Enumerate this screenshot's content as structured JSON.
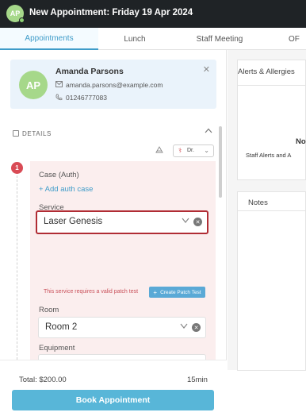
{
  "title_bar": {
    "avatar_initials": "AP",
    "title": "New Appointment: Friday 19 Apr 2024"
  },
  "tabs": [
    {
      "label": "Appointments",
      "active": true
    },
    {
      "label": "Lunch",
      "active": false
    },
    {
      "label": "Staff Meeting",
      "active": false
    },
    {
      "label": "OF",
      "active": false
    }
  ],
  "patient": {
    "initials": "AP",
    "name": "Amanda Parsons",
    "email": "amanda.parsons@example.com",
    "phone": "01246777083"
  },
  "details": {
    "heading": "DETAILS",
    "staff_select_value": "Dr.",
    "step_number": "1",
    "case_label": "Case (Auth)",
    "add_auth_label": "+ Add auth case",
    "service_label": "Service",
    "service_value": "Laser Genesis",
    "service_warning": "This service requires a valid patch test",
    "create_patch_test_label": "Create Patch Test",
    "room_label": "Room",
    "room_value": "Room 2",
    "equipment_label": "Equipment"
  },
  "footer": {
    "total": "Total: $200.00",
    "duration": "15min",
    "book_label": "Book Appointment"
  },
  "right_panel": {
    "alerts_title": "Alerts & Allergies",
    "alerts_empty_title": "No",
    "alerts_empty_sub": "Staff Alerts and A",
    "notes_title": "Notes"
  },
  "colors": {
    "title_bar": "#1f2326",
    "accent": "#3f9cc9",
    "book_button": "#58b6d8",
    "warning": "#c9505a",
    "highlight_border": "#b02c34",
    "service_panel": "#fbeeee",
    "patient_card": "#eaf3fb"
  },
  "icons": [
    "envelope-icon",
    "phone-icon",
    "close-icon",
    "calendar-icon",
    "chevron-up-icon",
    "chevron-down-icon",
    "staff-icon",
    "clear-icon",
    "plus-icon"
  ]
}
